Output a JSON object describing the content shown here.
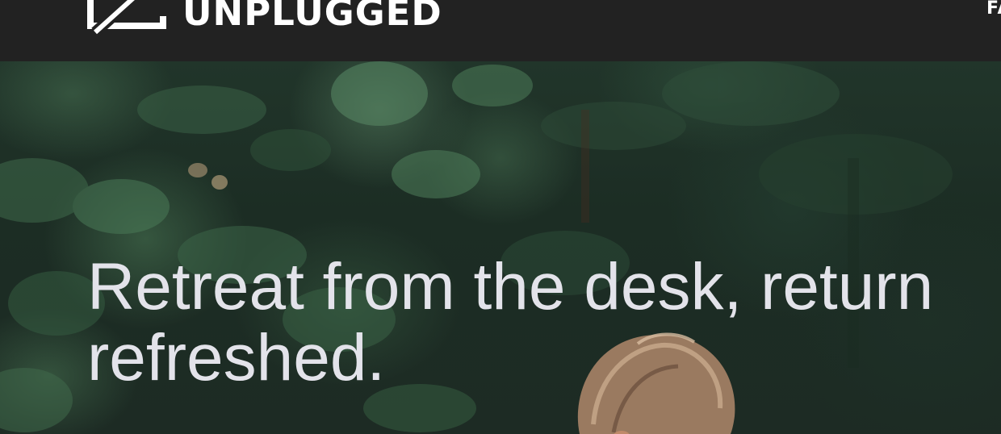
{
  "brand": {
    "name": "UNPLUGGED",
    "logo_icon": "unplugged-logo-icon"
  },
  "nav": {
    "items": [
      {
        "label": "FA"
      }
    ]
  },
  "hero": {
    "heading_line1": "Retreat from the desk, return",
    "heading_line2": "refreshed.",
    "background_image": "forest-photo-with-person"
  },
  "colors": {
    "topbar": "#222222",
    "heading_text": "#e3e3ea",
    "forest_dark": "#1d2b24"
  }
}
